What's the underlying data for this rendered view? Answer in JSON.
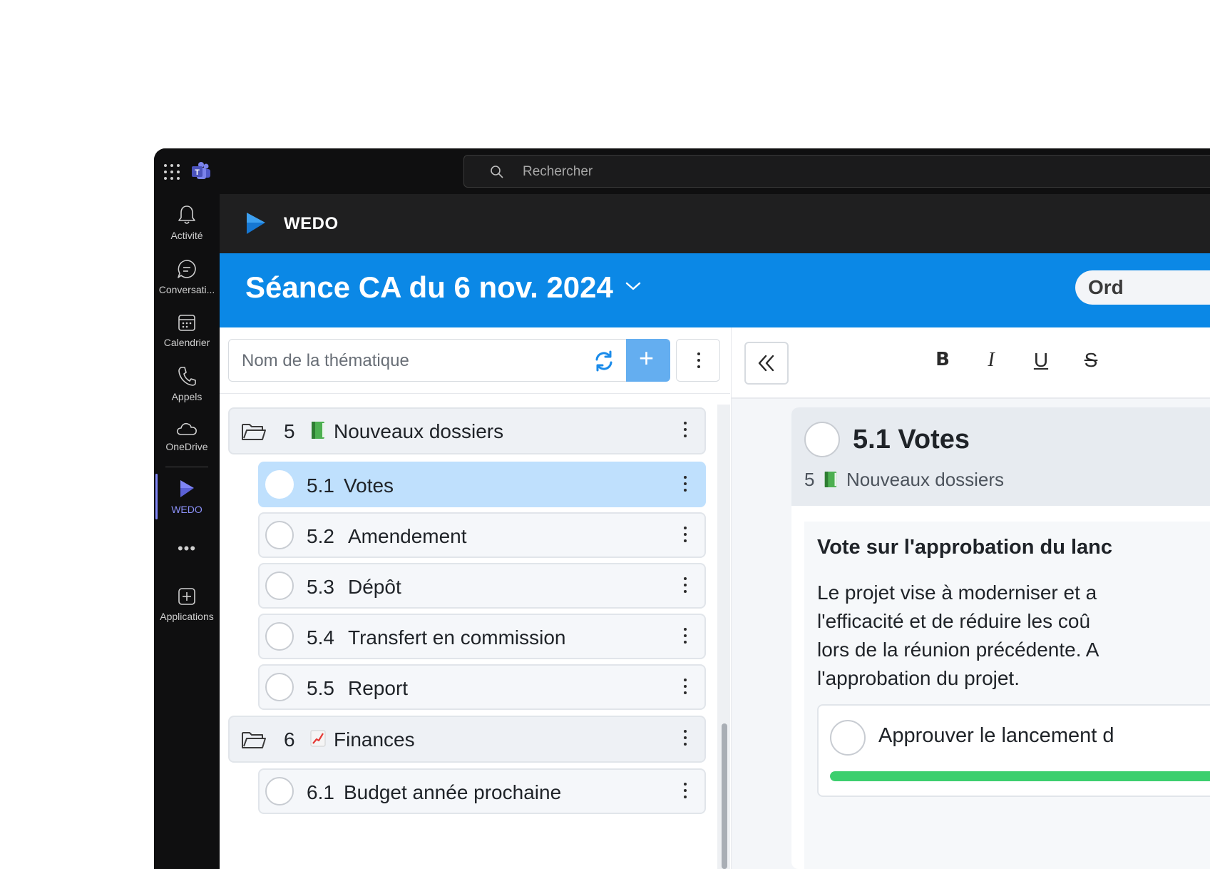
{
  "teams": {
    "search_placeholder": "Rechercher"
  },
  "rail": {
    "items": [
      {
        "label": "Activité",
        "icon": "bell-icon"
      },
      {
        "label": "Conversati...",
        "icon": "chat-icon"
      },
      {
        "label": "Calendrier",
        "icon": "calendar-icon"
      },
      {
        "label": "Appels",
        "icon": "phone-icon"
      },
      {
        "label": "OneDrive",
        "icon": "cloud-icon"
      },
      {
        "label": "WEDO",
        "icon": "wedo-icon",
        "active": true
      },
      {
        "label": "Applications",
        "icon": "plus-square-icon"
      }
    ],
    "more": "•••"
  },
  "app": {
    "name": "WEDO",
    "meeting_title": "Séance CA du 6 nov. 2024",
    "order_button": "Ord"
  },
  "topics": {
    "filter_placeholder": "Nom de la thématique",
    "add_label": "+",
    "groups": [
      {
        "number": "5",
        "emoji": "green-book",
        "label": "Nouveaux dossiers",
        "items": [
          {
            "number": "5.1",
            "label": "Votes",
            "selected": true
          },
          {
            "number": "5.2",
            "label": "Amendement"
          },
          {
            "number": "5.3",
            "label": "Dépôt"
          },
          {
            "number": "5.4",
            "label": "Transfert en commission"
          },
          {
            "number": "5.5",
            "label": "Report"
          }
        ]
      },
      {
        "number": "6",
        "emoji": "chart-increasing",
        "label": "Finances",
        "items": [
          {
            "number": "6.1",
            "label": "Budget année prochaine"
          }
        ]
      }
    ]
  },
  "editor": {
    "bold": "B",
    "italic": "I",
    "underline": "U",
    "strike": "S"
  },
  "detail": {
    "title": "5.1  Votes",
    "parent_number": "5",
    "parent_label": "Nouveaux dossiers",
    "vote_title": "Vote sur l'approbation du lanc",
    "description_lines": [
      "Le projet vise à moderniser et a",
      "l'efficacité et de réduire les coû",
      "lors de la réunion précédente. A",
      "l'approbation du projet."
    ],
    "option_label": "Approuver le lancement d",
    "option_progress": 1.0
  },
  "colors": {
    "banner": "#0b88e6",
    "selected_row": "#bfe0fd",
    "progress": "#3ccf6e",
    "add_button": "#64aef0"
  }
}
